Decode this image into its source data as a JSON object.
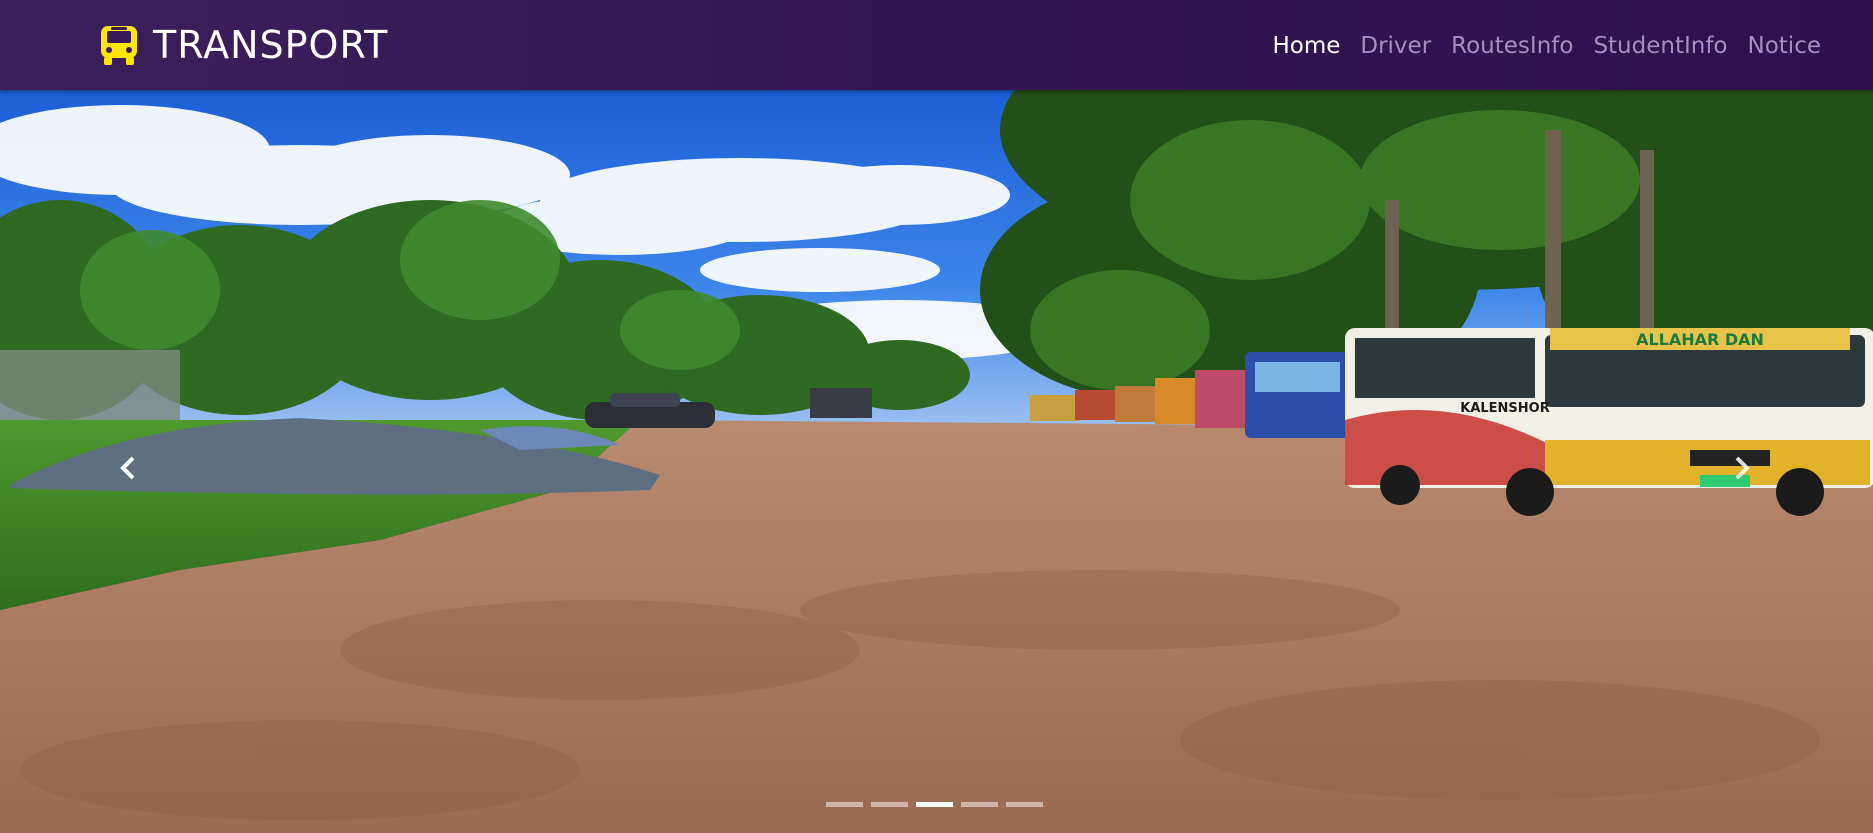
{
  "brand": {
    "name": "TRANSPORT",
    "icon": "bus-icon",
    "icon_color": "#ffe600"
  },
  "nav": {
    "items": [
      {
        "label": "Home",
        "active": true
      },
      {
        "label": "Driver",
        "active": false
      },
      {
        "label": "RoutesInfo",
        "active": false
      },
      {
        "label": "StudentInfo",
        "active": false
      },
      {
        "label": "Notice",
        "active": false
      }
    ]
  },
  "carousel": {
    "slide_count": 5,
    "active_slide": 3,
    "prev_icon": "chevron-left-icon",
    "next_icon": "chevron-right-icon",
    "bus_signage": "ALLAHAR DAN",
    "bus_side_text": "KALENSHOR"
  },
  "colors": {
    "nav_bg": "#361756",
    "nav_active": "#ffffff",
    "nav_inactive": "#a58fbd"
  }
}
